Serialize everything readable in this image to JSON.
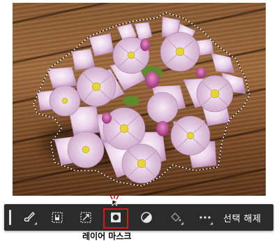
{
  "photo": {
    "description_icon": "flower-bouquet-photo"
  },
  "toolbar": {
    "buttons": [
      {
        "icon": "brush-icon"
      },
      {
        "icon": "select-subject-icon"
      },
      {
        "icon": "transform-selection-icon"
      },
      {
        "icon": "layer-mask-icon"
      },
      {
        "icon": "adjustment-icon"
      },
      {
        "icon": "fill-bucket-icon"
      },
      {
        "icon": "more-icon"
      }
    ],
    "deselect_label": "선택 해제",
    "highlight_color": "#e0141b"
  },
  "caption": "레이어 마스크"
}
